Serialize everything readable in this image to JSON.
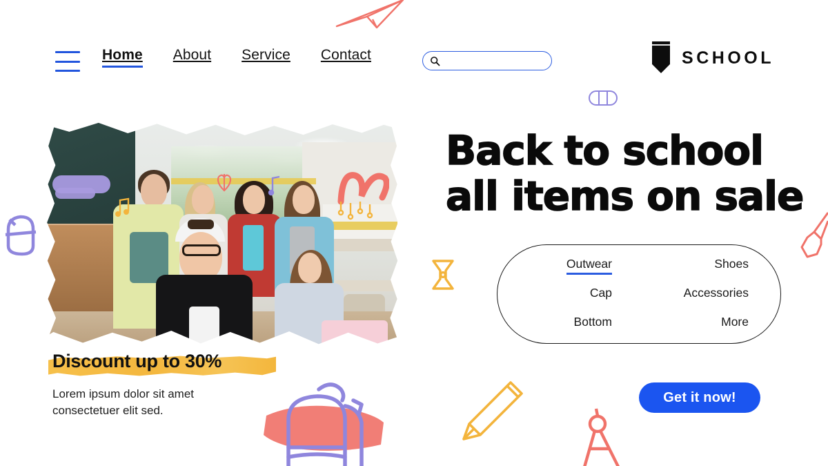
{
  "site": {
    "brand_name": "SCHOOL",
    "logo_icon": "pencil-shield-logo-icon",
    "accent_blue": "#1b55f0",
    "nav_blue": "#2255dd",
    "highlight_yellow": "#f4b73e",
    "doodle_purple": "#8f86dd",
    "doodle_coral": "#f0736a",
    "doodle_yellow": "#f3b43c"
  },
  "header": {
    "menu_icon": "hamburger-menu-icon",
    "nav": [
      {
        "label": "Home",
        "active": true
      },
      {
        "label": "About",
        "active": false
      },
      {
        "label": "Service",
        "active": false
      },
      {
        "label": "Contact",
        "active": false
      }
    ],
    "search": {
      "icon": "search-icon",
      "value": "",
      "placeholder": ""
    }
  },
  "hero": {
    "title_line1": "Back to school",
    "title_line2": "all items on sale",
    "cta_label": "Get it now!"
  },
  "categories": {
    "left_column": [
      {
        "label": "Outwear",
        "active": true
      },
      {
        "label": "Cap",
        "active": false
      },
      {
        "label": "Bottom",
        "active": false
      }
    ],
    "right_column": [
      {
        "label": "Shoes",
        "active": false
      },
      {
        "label": "Accessories",
        "active": false
      },
      {
        "label": "More",
        "active": false
      }
    ]
  },
  "promo": {
    "discount_text": "Discount up to 30%",
    "body_line1": "Lorem ipsum dolor sit amet",
    "body_line2": "consectetuer  elit sed."
  },
  "photo": {
    "alt": "group of smiling teenage students taking a selfie in a school cafeteria"
  },
  "doodles": [
    {
      "name": "paper-plane-doodle",
      "color": "#f0736a"
    },
    {
      "name": "eraser-doodle-top",
      "color": "#8f86dd"
    },
    {
      "name": "eraser-doodle-left",
      "color": "#8f86dd"
    },
    {
      "name": "pencil-sharpener-doodle",
      "color": "#f3b43c"
    },
    {
      "name": "paintbrush-doodle",
      "color": "#f0736a"
    },
    {
      "name": "backpack-doodle",
      "color": "#8f86dd"
    },
    {
      "name": "pencil-doodle",
      "color": "#f3b43c"
    },
    {
      "name": "compass-doodle",
      "color": "#f0736a"
    }
  ]
}
